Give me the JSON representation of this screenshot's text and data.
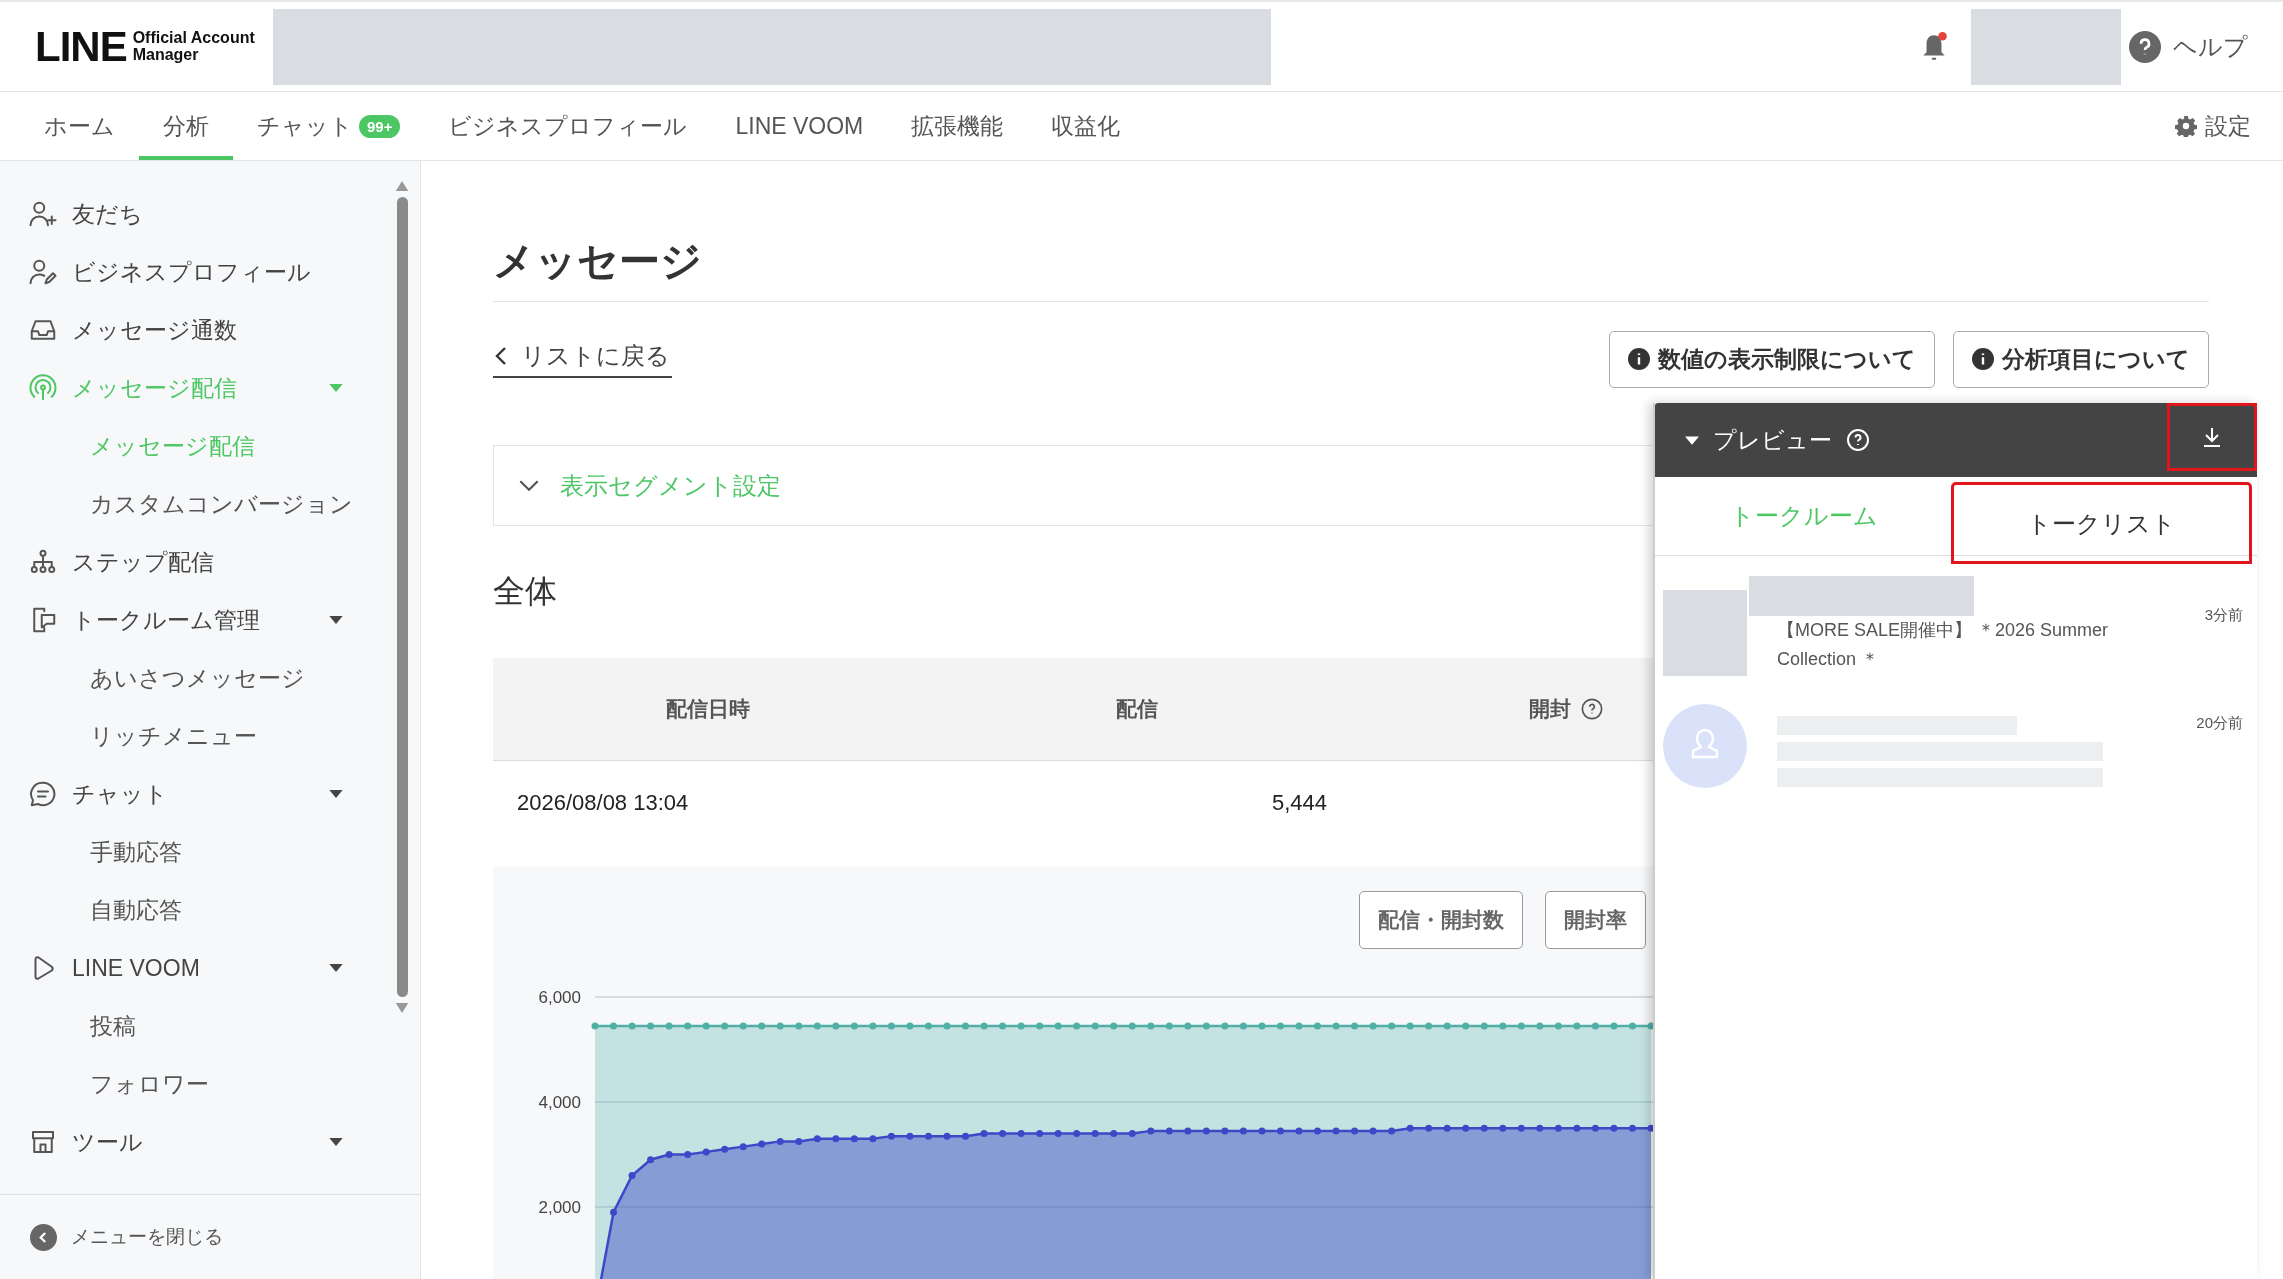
{
  "header": {
    "logo": {
      "wordmark": "LINE",
      "subtitle_lines": [
        "Official Account",
        "Manager"
      ]
    },
    "notifications": {
      "unread": true
    },
    "help": {
      "label": "ヘルプ"
    }
  },
  "nav": {
    "tabs": [
      {
        "label": "ホーム",
        "selected": false
      },
      {
        "label": "分析",
        "selected": true
      },
      {
        "label": "チャット",
        "selected": false,
        "badge": "99+"
      },
      {
        "label": "ビジネスプロフィール",
        "selected": false
      },
      {
        "label": "LINE VOOM",
        "selected": false
      },
      {
        "label": "拡張機能",
        "selected": false
      },
      {
        "label": "収益化",
        "selected": false
      }
    ],
    "settings": {
      "label": "設定"
    }
  },
  "sidebar": {
    "items": [
      {
        "label": "友だち",
        "selected": false
      },
      {
        "label": "ビジネスプロフィール",
        "selected": false
      },
      {
        "label": "メッセージ通数",
        "selected": false
      },
      {
        "label": "メッセージ配信",
        "selected": true,
        "expanded": true,
        "children": [
          {
            "label": "メッセージ配信",
            "selected": true
          },
          {
            "label": "カスタムコンバージョン",
            "selected": false
          }
        ]
      },
      {
        "label": "ステップ配信",
        "selected": false
      },
      {
        "label": "トークルーム管理",
        "selected": false,
        "expanded": true,
        "children": [
          {
            "label": "あいさつメッセージ",
            "selected": false
          },
          {
            "label": "リッチメニュー",
            "selected": false
          }
        ]
      },
      {
        "label": "チャット",
        "selected": false,
        "expanded": true,
        "children": [
          {
            "label": "手動応答",
            "selected": false
          },
          {
            "label": "自動応答",
            "selected": false
          }
        ]
      },
      {
        "label": "LINE VOOM",
        "selected": false,
        "expanded": true,
        "children": [
          {
            "label": "投稿",
            "selected": false
          },
          {
            "label": "フォロワー",
            "selected": false
          }
        ]
      },
      {
        "label": "ツール",
        "selected": false,
        "expanded": true
      }
    ],
    "close_menu": "メニューを閉じる"
  },
  "main": {
    "title": "メッセージ",
    "back_link": "リストに戻る",
    "info_buttons": [
      "数値の表示制限について",
      "分析項目について"
    ],
    "segment": {
      "label": "表示セグメント設定",
      "expanded": false
    },
    "section_title": "全体",
    "table": {
      "columns": [
        "配信日時",
        "配信",
        "開封"
      ],
      "rows": [
        [
          "2026/08/08 13:04",
          "5,444"
        ]
      ]
    },
    "chart_buttons": [
      "配信・開封数",
      "開封率"
    ],
    "chart_data": {
      "type": "area",
      "grid": true,
      "ylim": [
        0,
        6000
      ],
      "yticks": [
        {
          "value": 2000,
          "label": "2,000"
        },
        {
          "value": 4000,
          "label": "4,000"
        },
        {
          "value": 6000,
          "label": "6,000"
        }
      ],
      "series": [
        {
          "color": "#4fb0a8",
          "values": [
            5450,
            5450,
            5450,
            5450,
            5450,
            5450,
            5450,
            5450,
            5450,
            5450,
            5450,
            5450,
            5450,
            5450,
            5450,
            5450,
            5450,
            5450,
            5450,
            5450,
            5450,
            5450,
            5450,
            5450,
            5450,
            5450,
            5450,
            5450,
            5450,
            5450,
            5450,
            5450,
            5450,
            5450,
            5450,
            5450,
            5450,
            5450,
            5450,
            5450,
            5450,
            5450,
            5450,
            5450,
            5450,
            5450,
            5450,
            5450,
            5450,
            5450,
            5450,
            5450,
            5450,
            5450,
            5450,
            5450,
            5450,
            5450
          ]
        },
        {
          "color": "#3c48c8",
          "values": [
            0,
            1900,
            2600,
            2900,
            3000,
            3000,
            3050,
            3100,
            3150,
            3200,
            3250,
            3250,
            3300,
            3300,
            3300,
            3300,
            3350,
            3350,
            3350,
            3350,
            3350,
            3400,
            3400,
            3400,
            3400,
            3400,
            3400,
            3400,
            3400,
            3400,
            3450,
            3450,
            3450,
            3450,
            3450,
            3450,
            3450,
            3450,
            3450,
            3450,
            3450,
            3450,
            3450,
            3450,
            3500,
            3500,
            3500,
            3500,
            3500,
            3500,
            3500,
            3500,
            3500,
            3500,
            3500,
            3500,
            3500,
            3500
          ]
        }
      ]
    }
  },
  "preview": {
    "title": "プレビュー",
    "expanded": true,
    "download_highlighted": true,
    "tabs": [
      {
        "label": "トークルーム",
        "selected": false,
        "highlighted": false
      },
      {
        "label": "トークリスト",
        "selected": true,
        "highlighted": true
      }
    ],
    "chats": [
      {
        "kind": "image",
        "message": "【MORE SALE開催中】 ＊2026 Summer Collection ＊",
        "time": "3分前"
      },
      {
        "kind": "avatar",
        "time": "20分前"
      }
    ]
  }
}
